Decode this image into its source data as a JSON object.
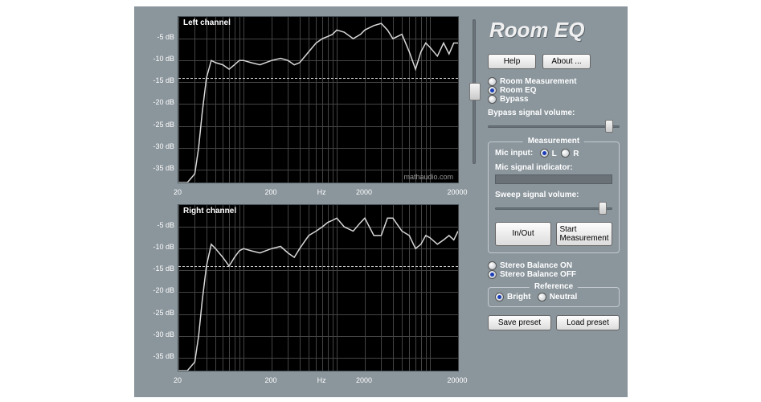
{
  "app_title": "Room EQ",
  "buttons": {
    "help": "Help",
    "about": "About ...",
    "in_out": "In/Out",
    "start_measurement": "Start Measurement",
    "save_preset": "Save preset",
    "load_preset": "Load preset"
  },
  "mode": {
    "room_measurement": "Room Measurement",
    "room_eq": "Room EQ",
    "bypass": "Bypass",
    "selected": "room_eq"
  },
  "bypass_volume_label": "Bypass signal volume:",
  "bypass_volume_pos": 0.96,
  "measurement": {
    "group_label": "Measurement",
    "mic_input_label": "Mic input:",
    "mic_L": "L",
    "mic_R": "R",
    "mic_selected": "L",
    "mic_indicator_label": "Mic signal indicator:",
    "sweep_label": "Sweep signal volume:",
    "sweep_pos": 0.96
  },
  "stereo": {
    "on": "Stereo Balance ON",
    "off": "Stereo Balance OFF",
    "selected": "off"
  },
  "reference": {
    "group_label": "Reference",
    "bright": "Bright",
    "neutral": "Neutral",
    "selected": "bright"
  },
  "charts": {
    "left_title": "Left channel",
    "right_title": "Right channel",
    "watermark": "mathaudio.com",
    "y_ticks": [
      -5,
      -10,
      -15,
      -20,
      -25,
      -30,
      -35
    ],
    "y_unit": "dB",
    "x_ticks": [
      20,
      200,
      2000,
      20000
    ],
    "x_tick_labels": [
      "20",
      "200",
      "2000",
      "20000"
    ],
    "x_center_label": "Hz",
    "goal_db": -14
  },
  "chart_data": [
    {
      "type": "line",
      "title": "Left channel",
      "xlabel": "Hz",
      "ylabel": "dB",
      "xscale": "log",
      "xlim": [
        20,
        20000
      ],
      "ylim": [
        -38,
        0
      ],
      "series": [
        {
          "name": "response",
          "x": [
            20,
            25,
            30,
            33,
            36,
            40,
            45,
            50,
            60,
            70,
            80,
            90,
            100,
            120,
            150,
            200,
            250,
            300,
            350,
            400,
            500,
            600,
            700,
            800,
            900,
            1000,
            1200,
            1500,
            1800,
            2000,
            2500,
            3000,
            3500,
            4000,
            5000,
            6000,
            7000,
            8000,
            9000,
            10000,
            12000,
            14000,
            16000,
            18000,
            20000
          ],
          "y": [
            -38,
            -38,
            -36,
            -30,
            -22,
            -14,
            -10,
            -10.5,
            -11,
            -12,
            -11,
            -10,
            -10,
            -10.5,
            -11,
            -10,
            -9.5,
            -10,
            -11,
            -10.5,
            -8,
            -6,
            -5,
            -4.5,
            -4,
            -3,
            -3.5,
            -5,
            -4,
            -3,
            -2,
            -1.5,
            -3,
            -5,
            -4,
            -8,
            -12,
            -8,
            -6,
            -7,
            -9,
            -6,
            -8.5,
            -6,
            -6
          ]
        }
      ]
    },
    {
      "type": "line",
      "title": "Right channel",
      "xlabel": "Hz",
      "ylabel": "dB",
      "xscale": "log",
      "xlim": [
        20,
        20000
      ],
      "ylim": [
        -38,
        0
      ],
      "series": [
        {
          "name": "response",
          "x": [
            20,
            25,
            30,
            33,
            36,
            40,
            45,
            50,
            60,
            70,
            80,
            90,
            100,
            120,
            150,
            200,
            250,
            300,
            350,
            400,
            500,
            600,
            700,
            800,
            900,
            1000,
            1200,
            1500,
            1800,
            2000,
            2500,
            3000,
            3500,
            4000,
            5000,
            6000,
            7000,
            8000,
            9000,
            10000,
            12000,
            14000,
            16000,
            18000,
            20000
          ],
          "y": [
            -38,
            -38,
            -36,
            -30,
            -22,
            -14,
            -9,
            -10,
            -12,
            -14,
            -12,
            -10.5,
            -10,
            -10.5,
            -11,
            -10,
            -9.5,
            -11,
            -12,
            -10,
            -7,
            -6,
            -5,
            -4,
            -3.5,
            -3,
            -5,
            -6,
            -4,
            -3,
            -7,
            -7,
            -3,
            -3,
            -6,
            -7,
            -10,
            -9,
            -7,
            -7.5,
            -9,
            -8,
            -7,
            -8,
            -6
          ]
        }
      ]
    }
  ]
}
